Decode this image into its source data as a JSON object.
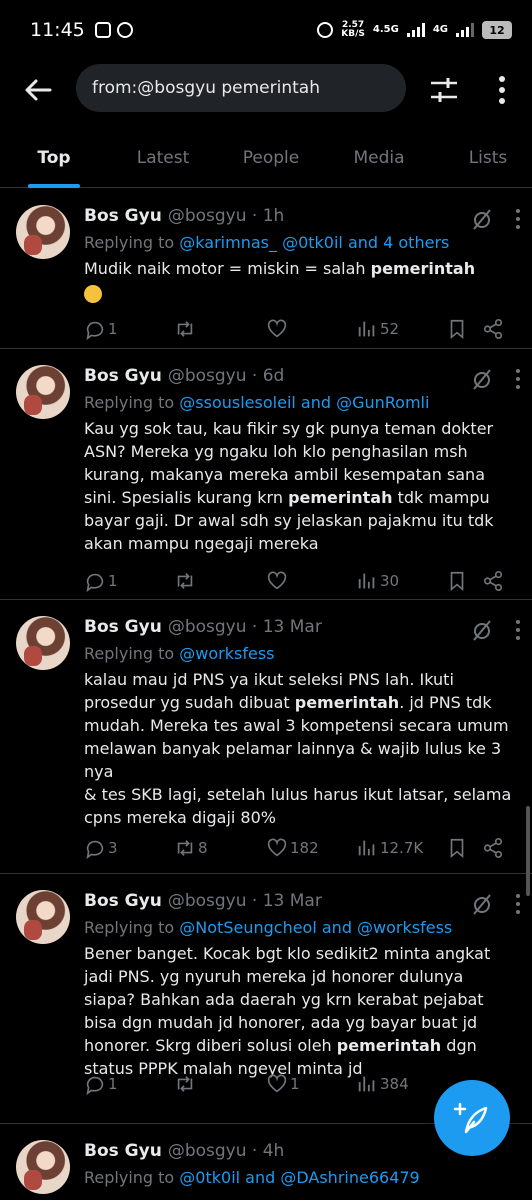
{
  "status_bar": {
    "time": "11:45",
    "data_rate": "2.57",
    "data_unit": "KB/S",
    "network_1": "4.5G",
    "network_2": "4G",
    "battery": "12"
  },
  "search": {
    "query": "from:@bosgyu pemerintah"
  },
  "tabs": [
    "Top",
    "Latest",
    "People",
    "Media",
    "Lists"
  ],
  "tweets": [
    {
      "name": "Bos Gyu",
      "handle_time": "@bosgyu · 1h",
      "replying_prefix": "Replying to ",
      "replying_mentions": "@karimnas_ @0tk0il and 4 others",
      "text_before": "Mudik naik motor = miskin = salah ",
      "keyword": "pemerintah",
      "text_after": "",
      "emoji": "grinning-face-with-sweat",
      "replies": "1",
      "retweets": "",
      "likes": "",
      "views": "52"
    },
    {
      "name": "Bos Gyu",
      "handle_time": "@bosgyu · 6d",
      "replying_prefix": "Replying to ",
      "replying_mentions": "@ssouslesoleil and @GunRomli",
      "text_before": "Kau yg sok tau, kau fikir sy gk punya teman dokter ASN? Mereka yg ngaku loh klo penghasilan msh kurang, makanya mereka ambil kesempatan sana sini. Spesialis kurang krn ",
      "keyword": "pemerintah",
      "text_after": " tdk mampu bayar gaji. Dr awal sdh sy jelaskan pajakmu itu tdk akan mampu ngegaji mereka",
      "replies": "1",
      "retweets": "",
      "likes": "",
      "views": "30"
    },
    {
      "name": "Bos Gyu",
      "handle_time": "@bosgyu · 13 Mar",
      "replying_prefix": "Replying to ",
      "replying_mentions": "@worksfess",
      "text_before": "kalau mau jd PNS ya ikut seleksi PNS lah. Ikuti prosedur yg sudah dibuat ",
      "keyword": "pemerintah",
      "text_after": ". jd PNS tdk mudah. Mereka tes awal 3 kompetensi secara umum melawan banyak pelamar lainnya & wajib lulus ke 3 nya\n& tes SKB lagi, setelah lulus harus ikut latsar, selama cpns mereka digaji 80%",
      "replies": "3",
      "retweets": "8",
      "likes": "182",
      "views": "12.7K"
    },
    {
      "name": "Bos Gyu",
      "handle_time": "@bosgyu · 13 Mar",
      "replying_prefix": "Replying to ",
      "replying_mentions": "@NotSeungcheol and @worksfess",
      "text_before": "Bener banget. Kocak bgt klo sedikit2 minta angkat jadi PNS. yg nyuruh mereka jd honorer dulunya siapa? Bahkan ada daerah yg krn kerabat pejabat bisa dgn mudah jd honorer, ada yg bayar buat jd honorer. Skrg diberi solusi oleh ",
      "keyword": "pemerintah",
      "text_after": " dgn status PPPK malah ngeyel minta jd",
      "replies": "1",
      "retweets": "",
      "likes": "1",
      "views": "384"
    },
    {
      "name": "Bos Gyu",
      "handle_time": "@bosgyu · 4h",
      "replying_prefix": "Replying to ",
      "replying_mentions": "@0tk0il and @DAshrine66479"
    }
  ],
  "icons": {
    "back": "arrow-left-icon",
    "filter": "sliders-icon",
    "more": "more-vertical-icon",
    "compose": "feather-plus-icon"
  },
  "colors": {
    "accent": "#1d9bf0",
    "background": "#000000",
    "muted": "#71767b"
  }
}
